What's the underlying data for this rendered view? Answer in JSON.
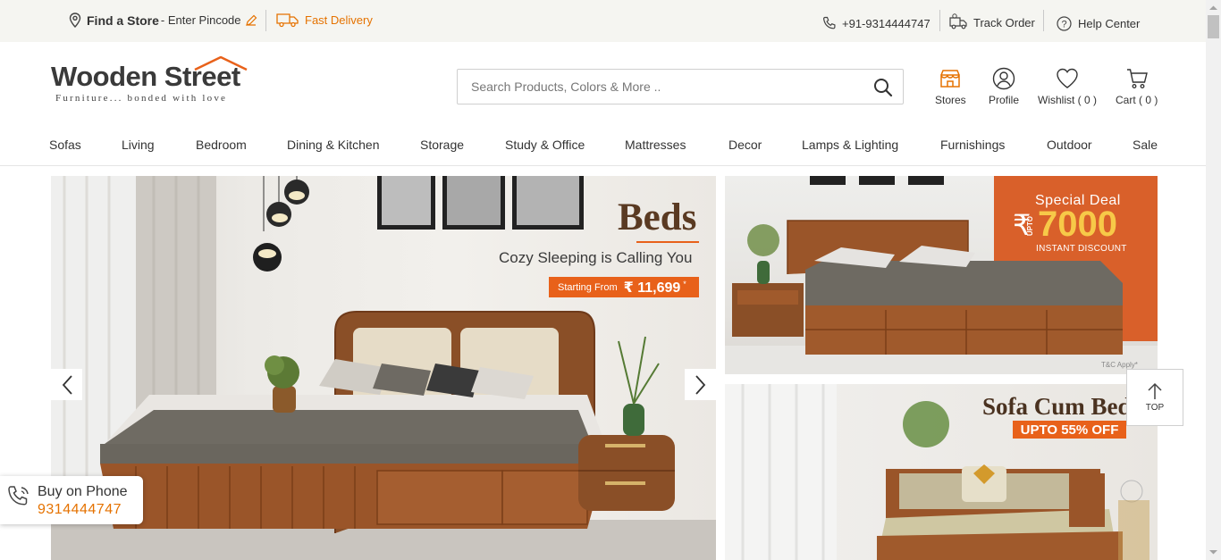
{
  "topbar": {
    "find_store": "Find a Store",
    "pincode": " - Enter Pincode",
    "fast_delivery": "Fast Delivery",
    "phone": "+91-9314444747",
    "track_order": "Track Order",
    "help_center": "Help Center"
  },
  "header": {
    "logo_main": "Wooden Street",
    "logo_tagline": "Furniture... bonded with love",
    "search_placeholder": "Search Products, Colors & More ..",
    "stores": "Stores",
    "profile": "Profile",
    "wishlist": "Wishlist ( 0 )",
    "cart": "Cart ( 0 )"
  },
  "nav": {
    "items": [
      "Sofas",
      "Living",
      "Bedroom",
      "Dining & Kitchen",
      "Storage",
      "Study & Office",
      "Mattresses",
      "Decor",
      "Lamps & Lighting",
      "Furnishings",
      "Outdoor",
      "Sale"
    ]
  },
  "banners": {
    "main": {
      "title": "Beds",
      "subtitle": "Cozy Sleeping is Calling You",
      "price_label": "Starting From",
      "price": "₹ 11,699",
      "price_star": "*"
    },
    "right_top": {
      "deal": "Special Deal",
      "upto": "UPTO",
      "amount": "7000",
      "currency": "₹",
      "discount": "INSTANT DISCOUNT",
      "tc": "T&C Apply*"
    },
    "right_bottom": {
      "title": "Sofa Cum Bed",
      "offer": "UPTO 55% OFF"
    }
  },
  "top_button": "TOP",
  "buy_on_phone": {
    "label": "Buy on Phone",
    "number": "9314444747"
  },
  "colors": {
    "accent": "#e57200",
    "deal_bg": "#d9602a",
    "price_badge": "#e8611a"
  }
}
